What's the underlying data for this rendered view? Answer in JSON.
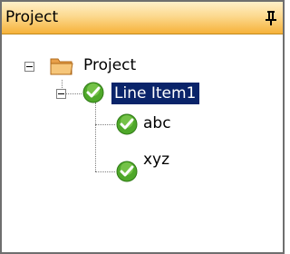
{
  "panel": {
    "title": "Project"
  },
  "tree": {
    "root": {
      "label": "Project",
      "icon": "folder-icon",
      "expanded": true
    },
    "line_item": {
      "label": "Line Item1",
      "icon": "green-check-icon",
      "expanded": true,
      "selected": true
    },
    "children": [
      {
        "label": "abc",
        "icon": "green-check-icon"
      },
      {
        "label": "xyz",
        "icon": "green-check-icon"
      }
    ]
  },
  "colors": {
    "title_bar": "#f6b23a",
    "selection": "#0a246a",
    "check": "#4fa82a"
  }
}
